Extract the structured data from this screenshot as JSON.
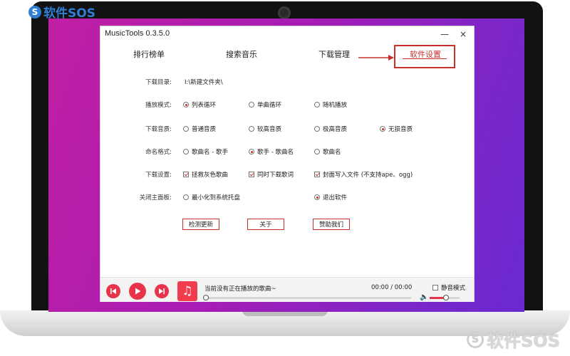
{
  "watermark": {
    "brand": "软件SOS",
    "logo_glyph": "S"
  },
  "window": {
    "title": "MusicTools 0.3.5.0",
    "minimize_icon": "—",
    "close_icon": "×"
  },
  "tabs": [
    {
      "label": "排行榜单",
      "active": false
    },
    {
      "label": "搜索音乐",
      "active": false
    },
    {
      "label": "下载管理",
      "active": false
    },
    {
      "label": "软件设置",
      "active": true
    }
  ],
  "settings": {
    "download_dir": {
      "label": "下载目录:",
      "value": "I:\\新建文件夹\\"
    },
    "play_mode": {
      "label": "播放模式:",
      "options": [
        {
          "label": "列表循环",
          "selected": true
        },
        {
          "label": "单曲循环",
          "selected": false
        },
        {
          "label": "随机播放",
          "selected": false
        }
      ]
    },
    "download_quality": {
      "label": "下载音质:",
      "options": [
        {
          "label": "普通音质",
          "selected": false
        },
        {
          "label": "较高音质",
          "selected": false
        },
        {
          "label": "极高音质",
          "selected": false
        },
        {
          "label": "无损音质",
          "selected": true
        }
      ]
    },
    "naming": {
      "label": "命名格式:",
      "options": [
        {
          "label": "歌曲名 - 歌手",
          "selected": false
        },
        {
          "label": "歌手 - 歌曲名",
          "selected": true
        },
        {
          "label": "歌曲名",
          "selected": false
        }
      ]
    },
    "download_settings": {
      "label": "下载设置:",
      "options": [
        {
          "label": "拯救灰色歌曲",
          "checked": true
        },
        {
          "label": "同时下载歌词",
          "checked": true
        },
        {
          "label": "封面写入文件 (不支持ape、ogg)",
          "checked": true
        }
      ]
    },
    "close_panel": {
      "label": "关闭主面板:",
      "options": [
        {
          "label": "最小化到系统托盘",
          "selected": false
        },
        {
          "label": "退出软件",
          "selected": true
        }
      ]
    },
    "buttons": {
      "check_update": "检测更新",
      "about": "关于",
      "donate": "赞助我们"
    }
  },
  "player": {
    "now_playing": "当前没有正在播放的歌曲~",
    "time": "00:00 / 00:00",
    "mute_label": "静音模式",
    "mute_checked": false,
    "progress": 0,
    "volume": 0.5,
    "icons": {
      "prev": "skip-previous-icon",
      "play": "play-icon",
      "next": "skip-next-icon",
      "music": "music-note-icon",
      "volume": "speaker-icon"
    }
  },
  "colors": {
    "accent": "#c8312b",
    "player_button": "#e8344a"
  }
}
